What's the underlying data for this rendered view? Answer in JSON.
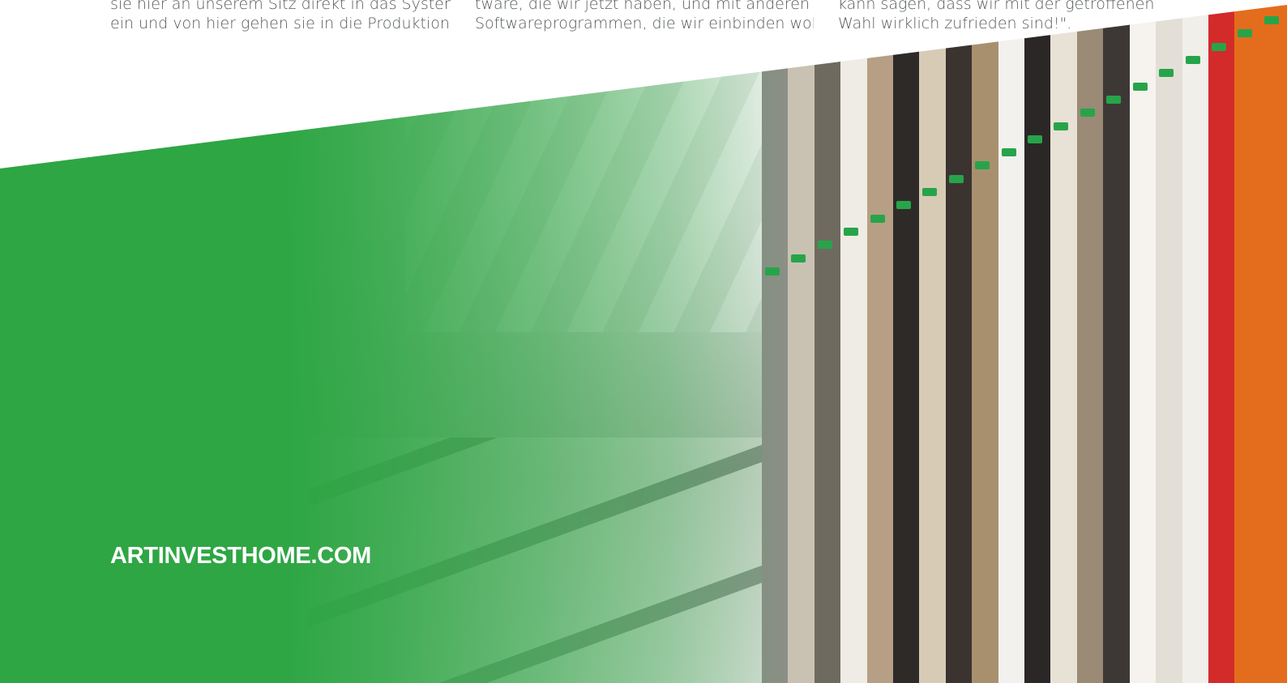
{
  "columns": [
    {
      "lines": [
        "sie hier an unserem Sitz direkt in das System",
        "ein und von hier gehen sie in die Produktion."
      ]
    },
    {
      "lines": [
        "tware, die wir jetzt haben, und mit anderen",
        "Softwareprogrammen, die wir einbinden wol-"
      ]
    },
    {
      "lines": [
        "kann sagen, dass wir mit der getroffenen",
        "Wahl wirklich zufrieden sind!\"."
      ]
    }
  ],
  "website": "ARTINVESTHOME.COM",
  "colors": {
    "brand_green": "#2ea644",
    "body_text": "#555a5e"
  },
  "wall_panel_colors": [
    "#8b8f86",
    "#c9c2b2",
    "#6f6a60",
    "#efece6",
    "#b69f84",
    "#2e2a28",
    "#d7cbb6",
    "#3a3330",
    "#a8906f",
    "#f2f1ee",
    "#2b2727",
    "#e8e1d6",
    "#9a8a76",
    "#3d3836",
    "#f6f3ee",
    "#e3dfd6",
    "#f1efea",
    "#d32a2a",
    "#e36d1c",
    "#e36d1c"
  ]
}
